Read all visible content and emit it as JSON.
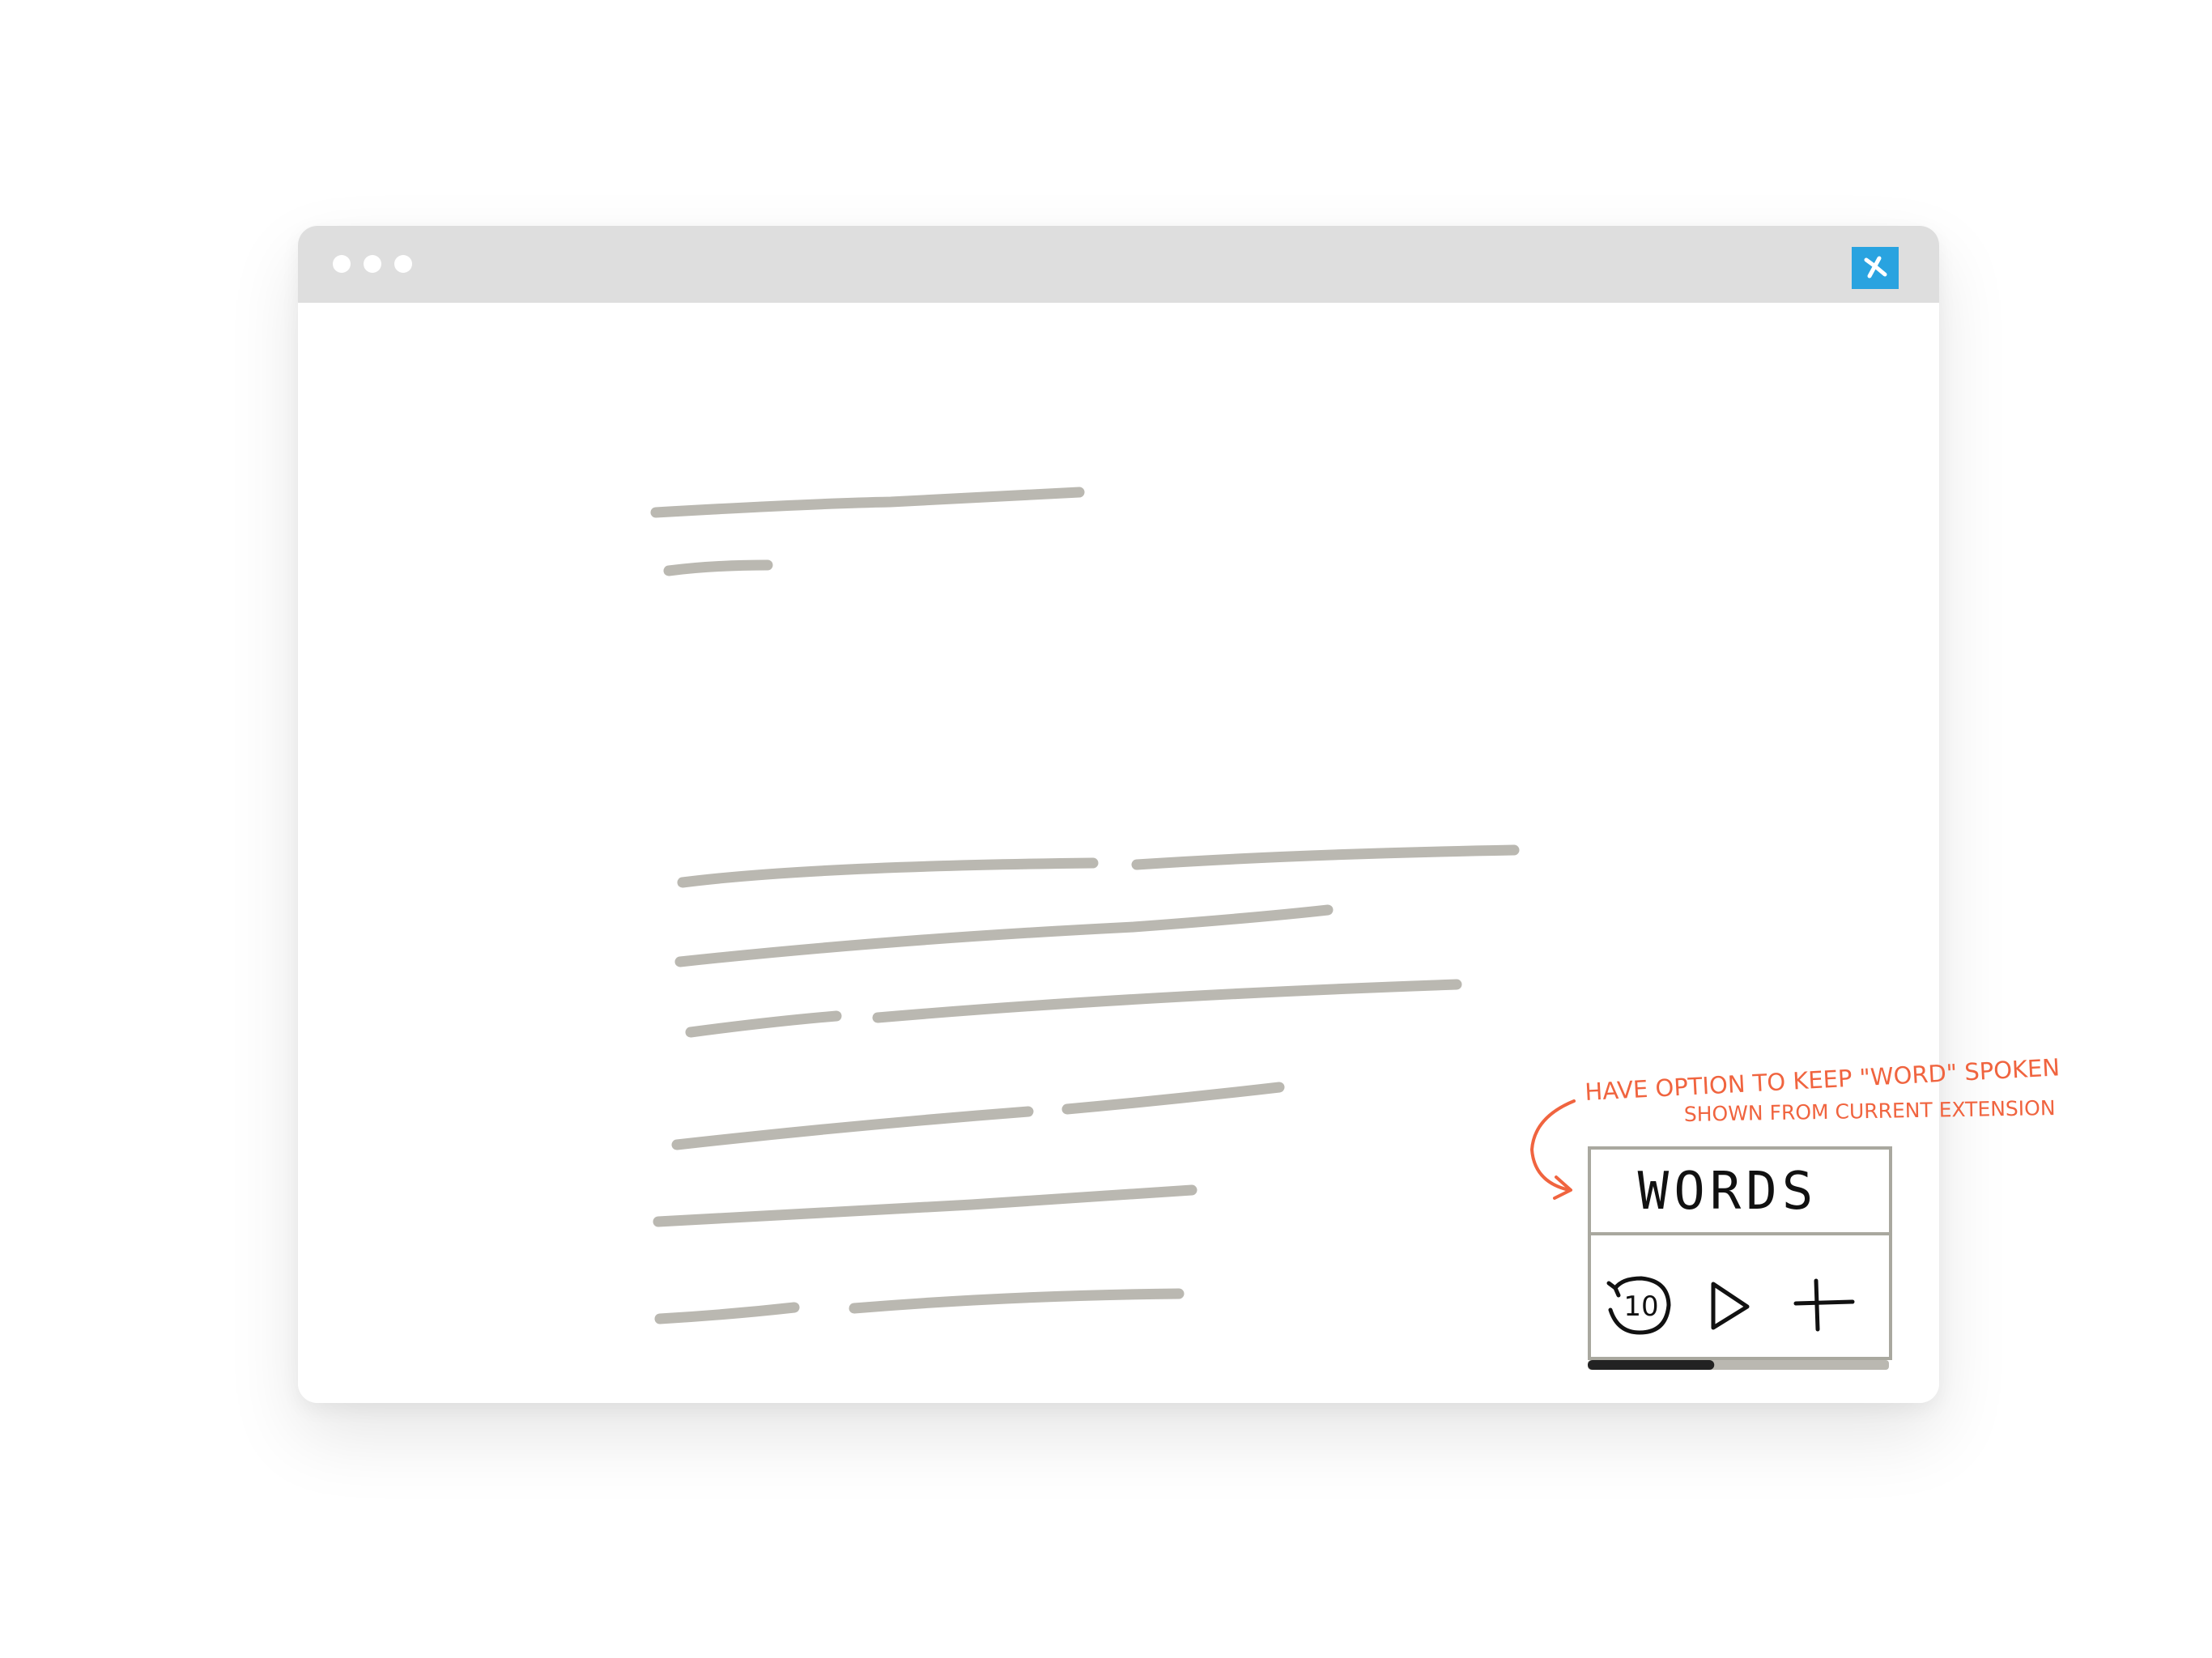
{
  "browser": {
    "window_dots": [
      "dot-1",
      "dot-2",
      "dot-3"
    ],
    "extension_icon": "extension-logo-icon",
    "extension_color": "#29a3e0",
    "titlebar_color": "#dedede"
  },
  "placeholder_text_color": "#bab8b1",
  "widget": {
    "display_text": "WORDS",
    "controls": {
      "rewind_label": "10",
      "rewind_icon": "rewind-10-icon",
      "play_icon": "play-icon",
      "add_icon": "plus-icon"
    },
    "progress": 0.42,
    "progress_track_color": "#bab8b1",
    "progress_fill_color": "#222222"
  },
  "annotation": {
    "line1": "HAVE OPTION TO KEEP \"WORD\" SPOKEN",
    "line2": "SHOWN FROM CURRENT EXTENSION",
    "color": "#f0643f"
  }
}
